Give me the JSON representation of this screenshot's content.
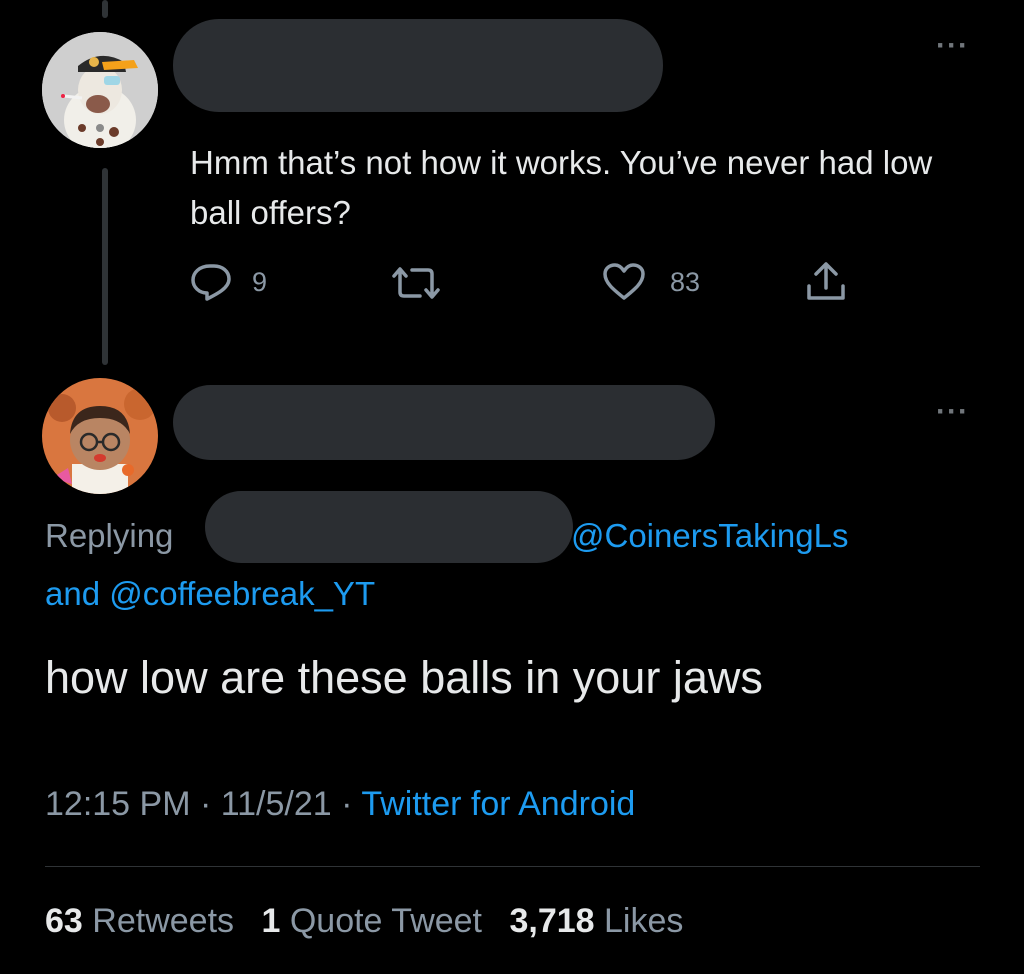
{
  "tweet1": {
    "text": "Hmm that’s not how it works. You’ve never had low ball offers?",
    "reply_count": "9",
    "retweet_count": "",
    "like_count": "83",
    "more_icon": "more-icon",
    "icons": [
      "reply-icon",
      "retweet-icon",
      "like-icon",
      "share-icon"
    ]
  },
  "tweet2": {
    "replying_label": "Replying",
    "mention_1": "@CoinersTakingLs",
    "and_label": "and",
    "mention_2": "@coffeebreak_YT",
    "text": "how low are these balls in your jaws",
    "time": "12:15 PM",
    "date": "11/5/21",
    "separator": "·",
    "source": "Twitter for Android",
    "retweets_count": "63",
    "retweets_label": "Retweets",
    "quote_count": "1",
    "quote_label": "Quote Tweet",
    "likes_count": "3,718",
    "likes_label": "Likes"
  },
  "colors": {
    "background": "#000000",
    "accent": "#1d9bf0",
    "muted": "#8b98a5",
    "text": "#e7e9ea"
  }
}
